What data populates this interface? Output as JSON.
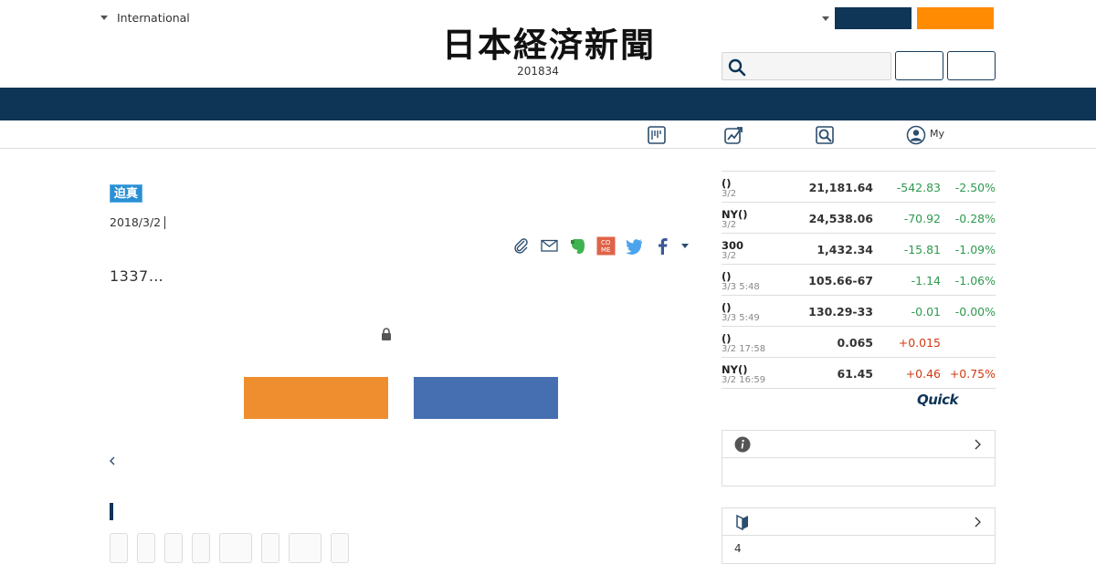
{
  "header": {
    "region_label": "International",
    "logo_text": "日本経済新聞",
    "issue_date": "201834"
  },
  "subnav": {
    "my_label": "My"
  },
  "article": {
    "badge": "迫真",
    "date": "2018/3/2",
    "lead": "1337…"
  },
  "markets": {
    "rows": [
      {
        "name": "()",
        "time": "3/2",
        "value": "21,181.64",
        "change": "-542.83",
        "pct": "-2.50%",
        "dir": "neg"
      },
      {
        "name": "NY()",
        "time": "3/2",
        "value": "24,538.06",
        "change": "-70.92",
        "pct": "-0.28%",
        "dir": "neg"
      },
      {
        "name": "300",
        "time": "3/2",
        "value": "1,432.34",
        "change": "-15.81",
        "pct": "-1.09%",
        "dir": "neg"
      },
      {
        "name": "()",
        "time": "3/3 5:48",
        "value": "105.66-67",
        "change": "-1.14",
        "pct": "-1.06%",
        "dir": "neg"
      },
      {
        "name": "()",
        "time": "3/3 5:49",
        "value": "130.29-33",
        "change": "-0.01",
        "pct": "-0.00%",
        "dir": "neg"
      },
      {
        "name": "()",
        "time": "3/2 17:58",
        "value": "0.065",
        "change": "+0.015",
        "pct": "",
        "dir": "pos"
      },
      {
        "name": "NY()",
        "time": "3/2 16:59",
        "value": "61.45",
        "change": "+0.46",
        "pct": "+0.75%",
        "dir": "pos"
      }
    ],
    "provider": "Quick"
  },
  "sidebar_box2": {
    "count": "4"
  },
  "colors": {
    "navy": "#0e3456",
    "orange": "#ff8b02",
    "down_green": "#2e9a4f",
    "up_red": "#d03a12",
    "cta_orange": "#ee8e2f",
    "cta_blue": "#466fb2"
  }
}
